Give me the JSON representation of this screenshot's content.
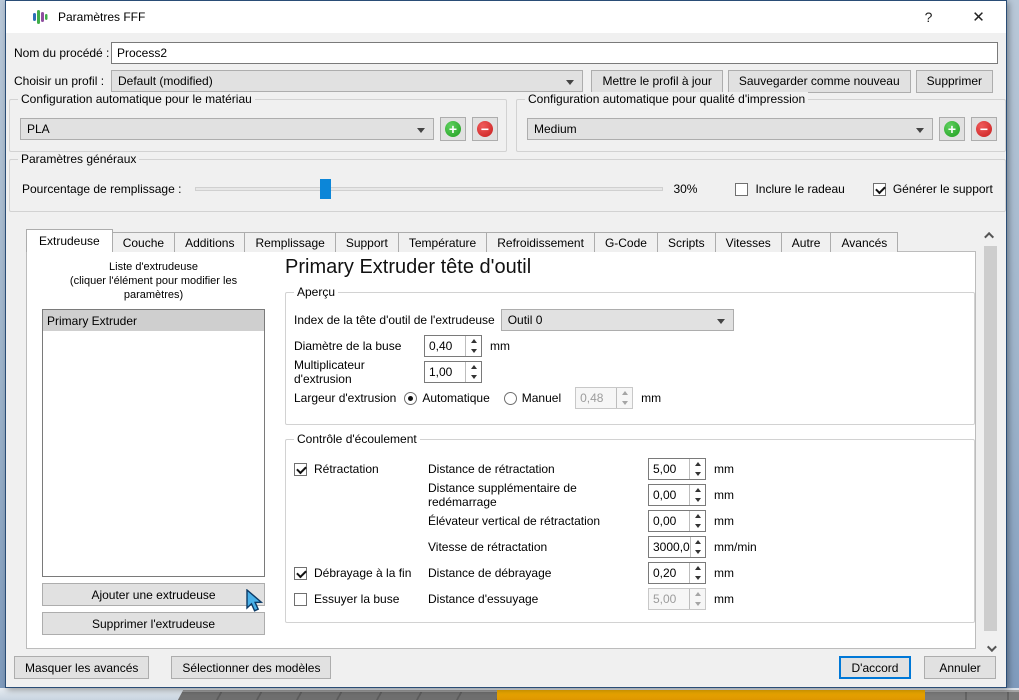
{
  "window": {
    "title": "Paramètres FFF",
    "help_icon": "?",
    "close_icon": "✕"
  },
  "process": {
    "label": "Nom du procédé :",
    "value": "Process2"
  },
  "profile": {
    "label": "Choisir un profil :",
    "value": "Default (modified)",
    "update_label": "Mettre le profil à jour",
    "save_as_label": "Sauvegarder comme nouveau",
    "delete_label": "Supprimer"
  },
  "material": {
    "title": "Configuration automatique pour le matériau",
    "value": "PLA"
  },
  "quality": {
    "title": "Configuration automatique pour qualité d'impression",
    "value": "Medium"
  },
  "general": {
    "title": "Paramètres généraux",
    "infill_label": "Pourcentage de remplissage :",
    "infill_value": "30%",
    "infill_percent": 30,
    "raft_label": "Inclure le radeau",
    "raft_checked": false,
    "support_label": "Générer le support",
    "support_checked": true
  },
  "tabs": [
    "Extrudeuse",
    "Couche",
    "Additions",
    "Remplissage",
    "Support",
    "Température",
    "Refroidissement",
    "G-Code",
    "Scripts",
    "Vitesses",
    "Autre",
    "Avancés"
  ],
  "active_tab": "Extrudeuse",
  "extruder_list": {
    "title": "Liste d'extrudeuse",
    "subtitle": "(cliquer l'élément pour modifier les paramètres)",
    "items": [
      "Primary Extruder"
    ],
    "add_label": "Ajouter une extrudeuse",
    "remove_label": "Supprimer l'extrudeuse"
  },
  "panel": {
    "heading": "Primary Extruder tête d'outil"
  },
  "overview": {
    "title": "Aperçu",
    "tool_label": "Index de la tête d'outil de l'extrudeuse",
    "tool_value": "Outil 0",
    "nozzle_label": "Diamètre de la buse",
    "nozzle_value": "0,40",
    "nozzle_unit": "mm",
    "multiplier_label": "Multiplicateur d'extrusion",
    "multiplier_value": "1,00",
    "width_label": "Largeur d'extrusion",
    "auto_label": "Automatique",
    "manual_label": "Manuel",
    "width_value": "0,48",
    "width_unit": "mm",
    "width_mode": "Automatique"
  },
  "ooze": {
    "title": "Contrôle d'écoulement",
    "checks": [
      {
        "label": "Rétractation",
        "checked": true
      },
      {
        "label": "Débrayage à la fin",
        "checked": true
      },
      {
        "label": "Essuyer la buse",
        "checked": false
      }
    ],
    "rows": [
      {
        "label": "Distance de rétractation",
        "value": "5,00",
        "unit": "mm"
      },
      {
        "label": "Distance supplémentaire de redémarrage",
        "value": "0,00",
        "unit": "mm"
      },
      {
        "label": "Élévateur vertical de rétractation",
        "value": "0,00",
        "unit": "mm"
      },
      {
        "label": "Vitesse de rétractation",
        "value": "3000,0",
        "unit": "mm/min"
      },
      {
        "label": "Distance de débrayage",
        "value": "0,20",
        "unit": "mm"
      },
      {
        "label": "Distance d'essuyage",
        "value": "5,00",
        "unit": "mm",
        "disabled": true
      }
    ]
  },
  "footer": {
    "hide_advanced_label": "Masquer les avancés",
    "select_models_label": "Sélectionner des modèles",
    "ok_label": "D'accord",
    "cancel_label": "Annuler"
  },
  "icons": {
    "add": "plus-circle-icon",
    "remove": "minus-circle-icon",
    "plus_glyph": "+",
    "minus_glyph": "−"
  },
  "colors": {
    "accent": "#0078d7",
    "slider_handle": "#0c86d8",
    "add_green": "#1e9e1e",
    "remove_red": "#c81e1e",
    "orange_bar": "#e8a000"
  }
}
